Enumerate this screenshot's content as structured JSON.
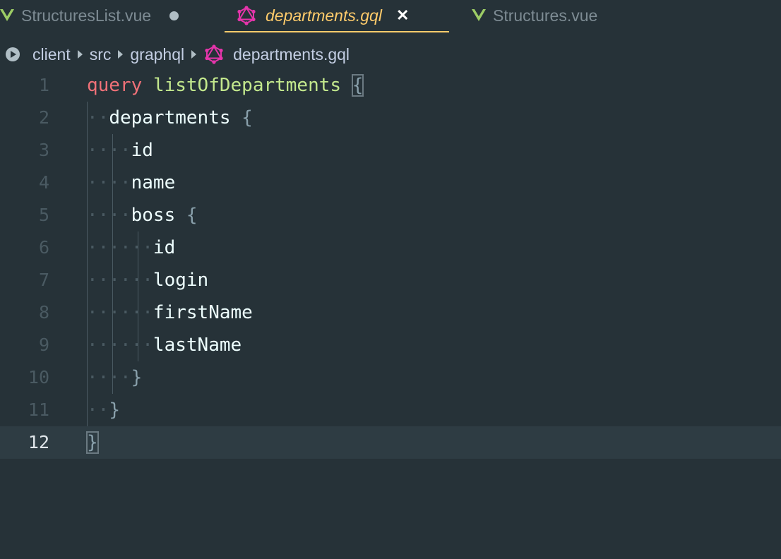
{
  "tabs": [
    {
      "label": "StructuresList.vue",
      "icon": "vue-icon",
      "modified": true
    },
    {
      "label": "departments.gql",
      "icon": "graphql-icon",
      "active": true
    },
    {
      "label": "Structures.vue",
      "icon": "vue-icon"
    }
  ],
  "breadcrumb": [
    "client",
    "src",
    "graphql",
    "departments.gql"
  ],
  "editor": {
    "current_line": 12,
    "lines": [
      {
        "num": "1",
        "kw": "query",
        "fn": "listOfDepartments",
        "brace": "{"
      },
      {
        "num": "2",
        "ws": "··",
        "text": "departments",
        "brace": "{"
      },
      {
        "num": "3",
        "ws": "····",
        "text": "id"
      },
      {
        "num": "4",
        "ws": "····",
        "text": "name"
      },
      {
        "num": "5",
        "ws": "····",
        "text": "boss",
        "brace": "{"
      },
      {
        "num": "6",
        "ws": "······",
        "text": "id"
      },
      {
        "num": "7",
        "ws": "······",
        "text": "login"
      },
      {
        "num": "8",
        "ws": "······",
        "text": "firstName"
      },
      {
        "num": "9",
        "ws": "······",
        "text": "lastName"
      },
      {
        "num": "10",
        "ws": "····",
        "brace": "}"
      },
      {
        "num": "11",
        "ws": "··",
        "brace": "}"
      },
      {
        "num": "12",
        "brace": "}"
      }
    ]
  },
  "colors": {
    "background": "#263238",
    "active_tab": "#ffcb6b",
    "keyword": "#f07178",
    "function": "#c3e88d",
    "graphql_icon": "#e535ab",
    "vue_icon": "#9ccc65"
  }
}
